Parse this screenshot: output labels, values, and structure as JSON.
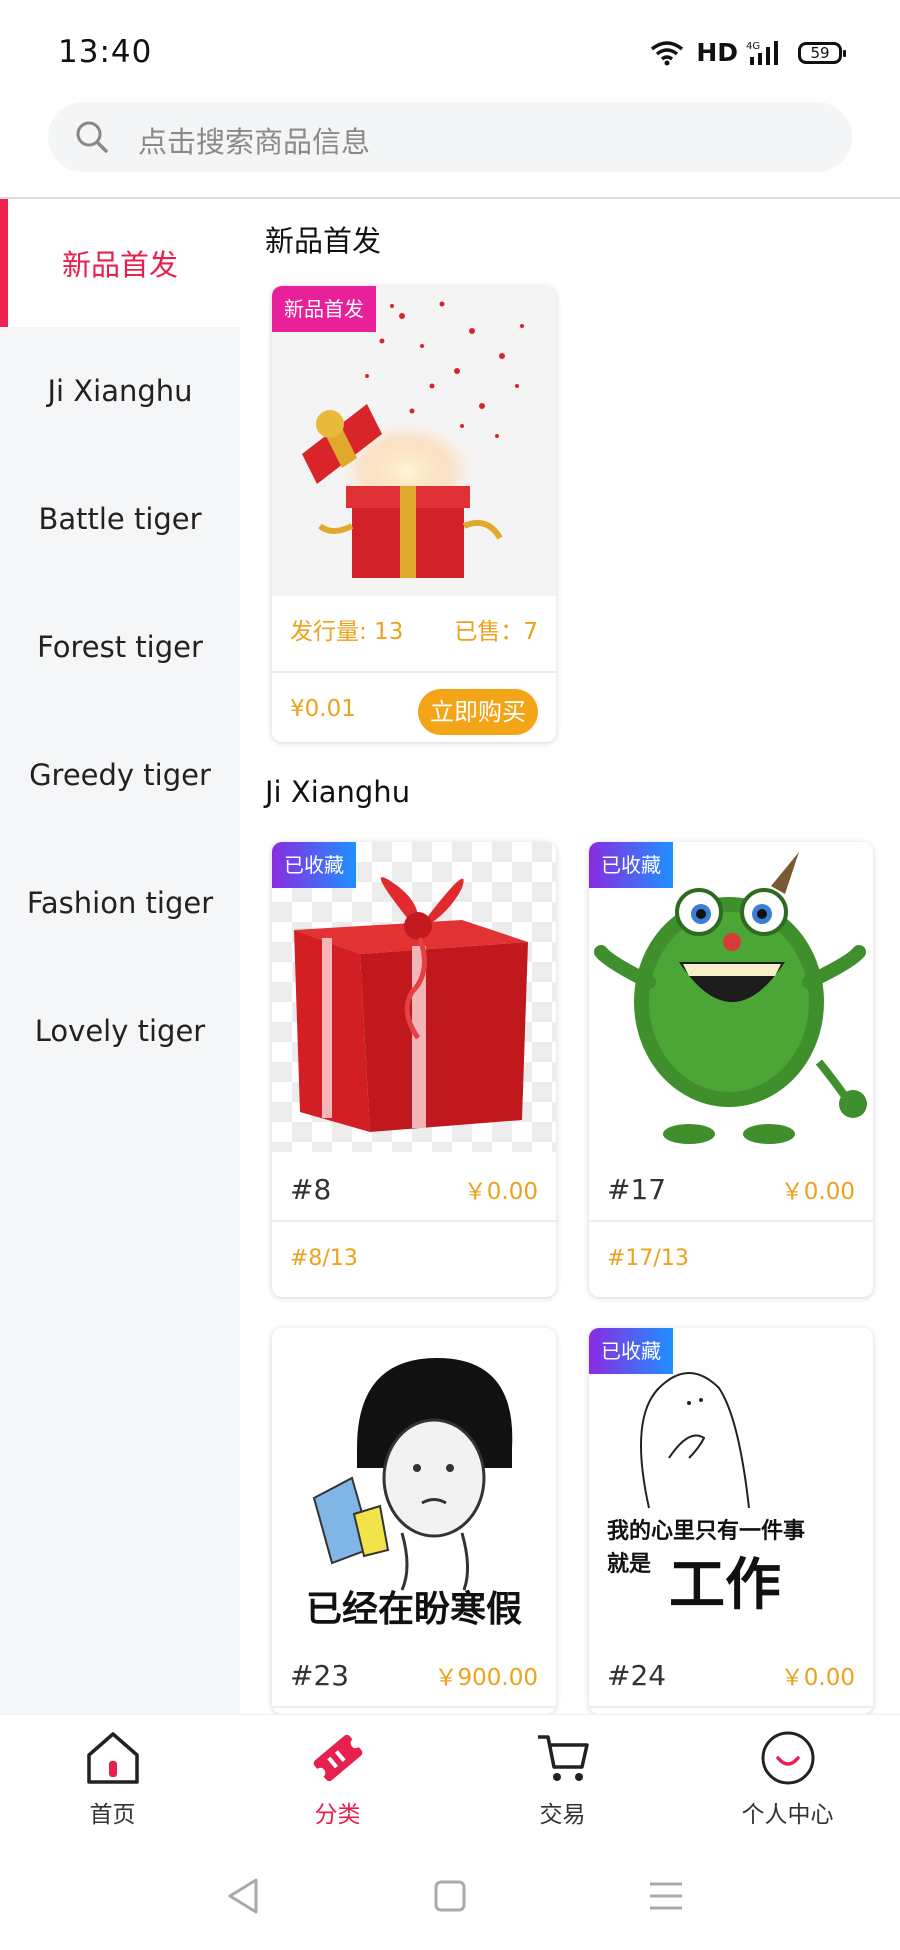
{
  "status_bar": {
    "time": "13:40",
    "network": "HD",
    "battery": "59"
  },
  "search": {
    "placeholder": "点击搜索商品信息"
  },
  "sidebar": {
    "items": [
      {
        "label": "新品首发",
        "active": true
      },
      {
        "label": "Ji Xianghu"
      },
      {
        "label": "Battle tiger"
      },
      {
        "label": "Forest tiger"
      },
      {
        "label": "Greedy tiger"
      },
      {
        "label": "Fashion tiger"
      },
      {
        "label": "Lovely tiger"
      }
    ]
  },
  "sections": [
    {
      "title": "新品首发",
      "product": {
        "badge": "新品首发",
        "issued_label": "发行量: 13",
        "sold_label": "已售：7",
        "price": "¥0.01",
        "buy_label": "立即购买"
      }
    },
    {
      "title": "Ji Xianghu",
      "items": [
        {
          "badge": "已收藏",
          "name": "#8",
          "price": "￥0.00",
          "edition": "#8/13"
        },
        {
          "badge": "已收藏",
          "name": "#17",
          "price": "￥0.00",
          "edition": "#17/13"
        },
        {
          "badge": "",
          "name": "#23",
          "price": "￥900.00",
          "image_text": "已经在盼寒假"
        },
        {
          "badge": "已收藏",
          "name": "#24",
          "price": "￥0.00",
          "image_text_line1": "我的心里只有一件事",
          "image_text_line2": "就是",
          "image_text_big": "工作"
        }
      ]
    }
  ],
  "tab_bar": {
    "tabs": [
      {
        "label": "首页",
        "icon": "home-icon"
      },
      {
        "label": "分类",
        "icon": "category-ticket-icon",
        "active": true
      },
      {
        "label": "交易",
        "icon": "cart-icon"
      },
      {
        "label": "个人中心",
        "icon": "smile-profile-icon"
      }
    ]
  },
  "colors": {
    "accent": "#e8204f",
    "amber": "#eca21c",
    "badge_gradient_start": "#8a2be2",
    "badge_gradient_end": "#1e90ff",
    "badge_pink": "#e8209a"
  }
}
